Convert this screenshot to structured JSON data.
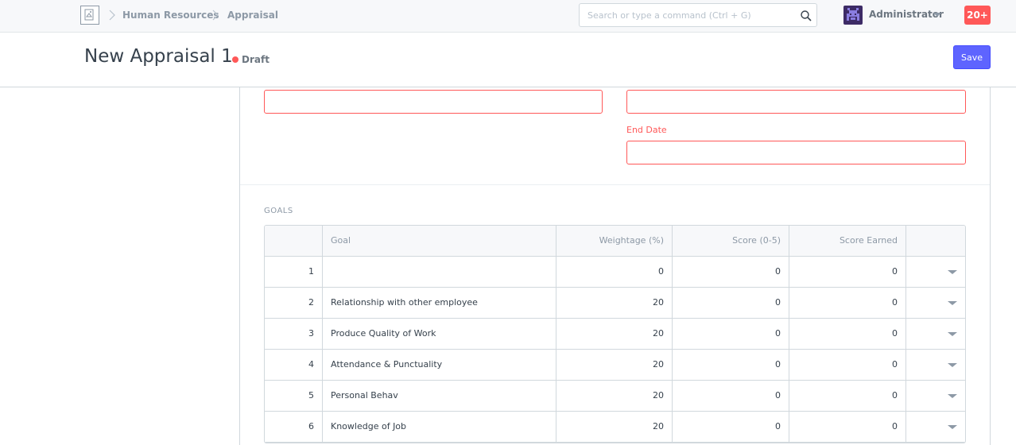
{
  "navbar": {
    "breadcrumbs": [
      "Human Resources",
      "Appraisal"
    ],
    "search_placeholder": "Search or type a command (Ctrl + G)",
    "user_name": "Administrator",
    "notification_count": "20+"
  },
  "page": {
    "title": "New Appraisal 1",
    "status": "Draft",
    "save_label": "Save"
  },
  "form": {
    "end_date_label": "End Date",
    "section_title": "GOALS"
  },
  "colors": {
    "accent": "#5e64ff",
    "error": "#ff5858",
    "text": "#36414c",
    "muted": "#8d99a6"
  },
  "goals": {
    "columns": [
      "Goal",
      "Weightage (%)",
      "Score (0-5)",
      "Score Earned"
    ],
    "rows": [
      {
        "idx": "1",
        "goal": "",
        "weightage": "0",
        "score": "0",
        "earned": "0"
      },
      {
        "idx": "2",
        "goal": "Relationship with other employee",
        "weightage": "20",
        "score": "0",
        "earned": "0"
      },
      {
        "idx": "3",
        "goal": "Produce Quality of Work",
        "weightage": "20",
        "score": "0",
        "earned": "0"
      },
      {
        "idx": "4",
        "goal": "Attendance & Punctuality",
        "weightage": "20",
        "score": "0",
        "earned": "0"
      },
      {
        "idx": "5",
        "goal": "Personal Behav",
        "weightage": "20",
        "score": "0",
        "earned": "0"
      },
      {
        "idx": "6",
        "goal": "Knowledge of Job",
        "weightage": "20",
        "score": "0",
        "earned": "0"
      }
    ]
  }
}
